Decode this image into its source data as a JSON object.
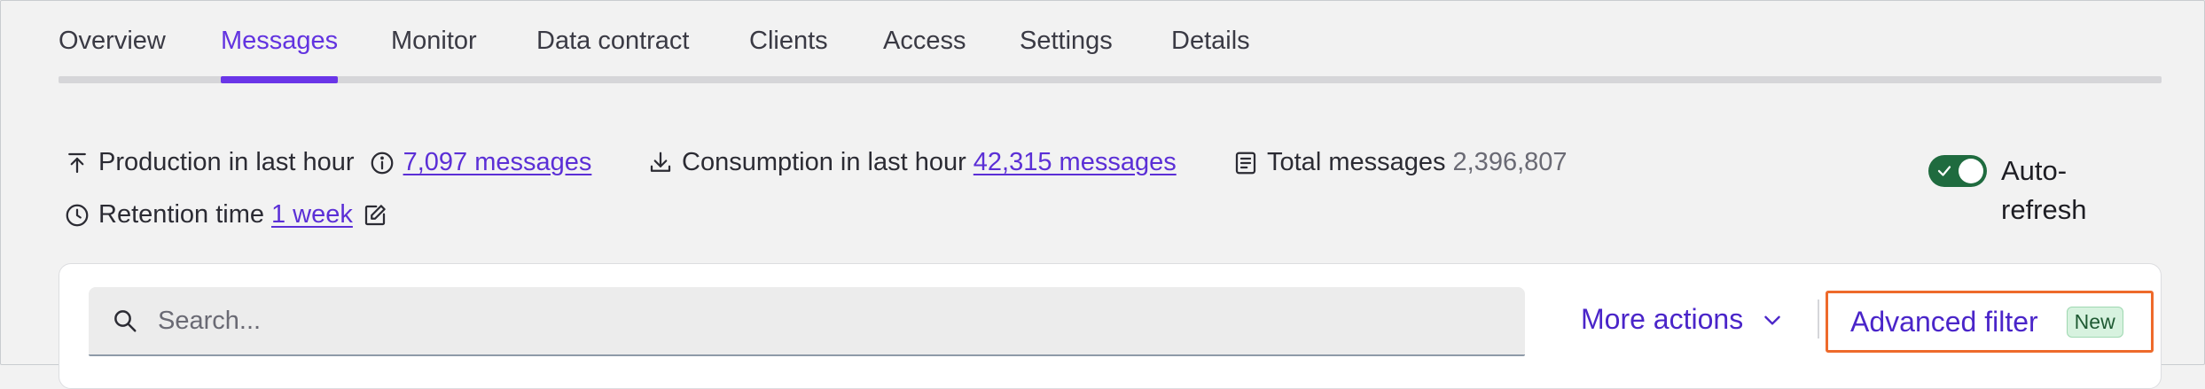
{
  "tabs": [
    {
      "label": "Overview"
    },
    {
      "label": "Messages"
    },
    {
      "label": "Monitor"
    },
    {
      "label": "Data contract"
    },
    {
      "label": "Clients"
    },
    {
      "label": "Access"
    },
    {
      "label": "Settings"
    },
    {
      "label": "Details"
    }
  ],
  "active_tab": "Messages",
  "stats": {
    "production": {
      "label": "Production in last hour",
      "value": "7,097 messages",
      "icon": "upload-icon"
    },
    "consumption": {
      "label": "Consumption in last hour",
      "value": "42,315 messages",
      "icon": "download-icon"
    },
    "total": {
      "label": "Total messages",
      "value": "2,396,807",
      "icon": "document-list-icon"
    },
    "retention": {
      "label": "Retention time",
      "value": "1 week",
      "icon": "clock-icon"
    }
  },
  "auto_refresh": {
    "label_line1": "Auto-",
    "label_line2": "refresh",
    "enabled": true
  },
  "search": {
    "placeholder": "Search...",
    "value": ""
  },
  "actions": {
    "more_actions": "More actions",
    "advanced_filter": "Advanced filter",
    "advanced_filter_badge": "New"
  },
  "colors": {
    "accent": "#6a36e8",
    "link": "#5b2fd6",
    "toggle_on": "#1f6b3f",
    "highlight_border": "#ee6a2b",
    "badge_bg": "#d7f2df"
  }
}
